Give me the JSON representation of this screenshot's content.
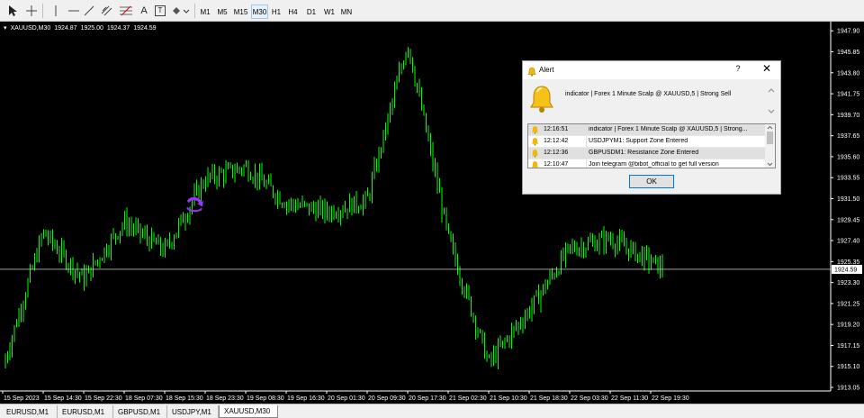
{
  "toolbar": {
    "tools": [
      {
        "icon": "cursor-arrow-icon"
      },
      {
        "icon": "crosshair-icon"
      },
      {
        "icon": "vertical-line-icon"
      },
      {
        "icon": "horizontal-line-icon"
      },
      {
        "icon": "trendline-icon"
      },
      {
        "icon": "channel-icon"
      },
      {
        "icon": "fibonacci-icon"
      },
      {
        "icon": "text-icon",
        "glyph": "A"
      },
      {
        "icon": "text-label-icon",
        "glyph": "T"
      },
      {
        "icon": "shapes-icon"
      }
    ],
    "timeframes": [
      "M1",
      "M5",
      "M15",
      "M30",
      "H1",
      "H4",
      "D1",
      "W1",
      "MN"
    ],
    "active_timeframe": "M30"
  },
  "chart": {
    "symbol_label": "XAUUSD,M30",
    "ohlc": [
      "1924.87",
      "1925.00",
      "1924.37",
      "1924.59"
    ],
    "current_price": "1924.59",
    "price_line_color": "#ffffff",
    "candle_color": "#00ff00",
    "background": "#000000",
    "arrow_color": "#9933ff"
  },
  "chart_data": {
    "type": "line",
    "title": "XAUUSD,M30",
    "xlabel": "",
    "ylabel": "",
    "ylim": [
      1912.7,
      1948.8
    ],
    "y_ticks": [
      "1947.90",
      "1945.85",
      "1943.80",
      "1941.75",
      "1939.70",
      "1937.65",
      "1935.60",
      "1933.55",
      "1931.50",
      "1929.45",
      "1927.40",
      "1925.35",
      "1923.30",
      "1921.25",
      "1919.20",
      "1917.15",
      "1915.10",
      "1913.05"
    ],
    "x_ticks": [
      "15 Sep 2023",
      "15 Sep 14:30",
      "15 Sep 22:30",
      "18 Sep 07:30",
      "18 Sep 15:30",
      "18 Sep 23:30",
      "19 Sep 08:30",
      "19 Sep 16:30",
      "20 Sep 01:30",
      "20 Sep 09:30",
      "20 Sep 17:30",
      "21 Sep 02:30",
      "21 Sep 10:30",
      "21 Sep 18:30",
      "22 Sep 03:30",
      "22 Sep 11:30",
      "22 Sep 19:30"
    ],
    "series": [
      {
        "name": "XAUUSD,M30",
        "x": [
          "15 Sep 2023",
          "15 Sep 14:30",
          "15 Sep 22:30",
          "18 Sep 07:30",
          "18 Sep 15:30",
          "18 Sep 23:30",
          "19 Sep 08:30",
          "19 Sep 16:30",
          "20 Sep 01:30",
          "20 Sep 09:30",
          "20 Sep 17:30",
          "21 Sep 02:30",
          "21 Sep 10:30",
          "21 Sep 18:30",
          "22 Sep 03:30",
          "22 Sep 11:30",
          "22 Sep 19:30"
        ],
        "values": [
          1915.0,
          1928.2,
          1923.6,
          1929.2,
          1926.4,
          1933.4,
          1934.6,
          1931.1,
          1930.2,
          1931.3,
          1946.8,
          1927.7,
          1915.4,
          1920.6,
          1926.6,
          1927.6,
          1924.6
        ]
      }
    ],
    "current_price": 1924.59,
    "signal_arrow": {
      "x": "18 Sep 15:30",
      "y": 1930.9,
      "direction": "sell"
    },
    "grid": false
  },
  "alert": {
    "title": "Alert",
    "help": "?",
    "close": "✕",
    "message": "indicator | Forex 1 Minute Scalp @ XAUUSD,5 | Strong Sell",
    "rows": [
      {
        "time": "12:16:51",
        "text": "indicator | Forex 1 Minute Scalp @ XAUUSD,5 | Strong..."
      },
      {
        "time": "12:12:42",
        "text": "USDJPYM1: Support Zone Entered"
      },
      {
        "time": "12:12:36",
        "text": "GBPUSDM1: Resistance Zone Entered"
      },
      {
        "time": "12:10:47",
        "text": "Join telegram @bibot_official to get full version"
      }
    ],
    "ok_label": "OK"
  },
  "tabs": [
    "EURUSD,M1",
    "EURUSD,M1",
    "GBPUSD,M1",
    "USDJPY,M1",
    "XAUUSD,M30"
  ],
  "active_tab": "XAUUSD,M30"
}
